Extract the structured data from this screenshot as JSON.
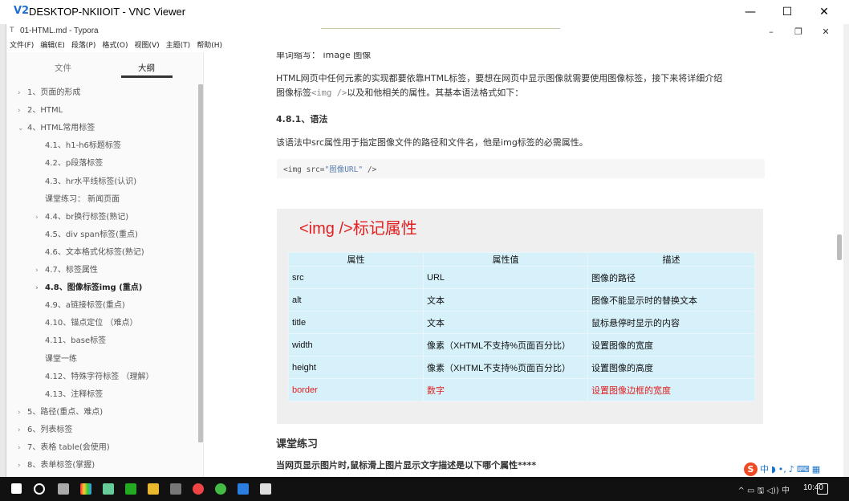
{
  "vnc": {
    "logo": "V2",
    "title": "DESKTOP-NKIIOIT - VNC Viewer",
    "minimize": "—",
    "maximize": "☐",
    "close": "✕"
  },
  "typora": {
    "title": "01-HTML.md - Typora",
    "icon": "T",
    "minimize": "–",
    "restore": "❐",
    "close": "✕"
  },
  "menu": [
    "文件(F)",
    "编辑(E)",
    "段落(P)",
    "格式(O)",
    "视图(V)",
    "主题(T)",
    "帮助(H)"
  ],
  "sidebar": {
    "tab_files": "文件",
    "tab_outline": "大纲",
    "items": [
      {
        "arrow": "›",
        "label": "1、页面的形成"
      },
      {
        "arrow": "›",
        "label": "2、HTML"
      },
      {
        "arrow": "⌄",
        "label": "4、HTML常用标签"
      },
      {
        "arrow": "",
        "label": "4.1、h1-h6标题标签"
      },
      {
        "arrow": "",
        "label": "4.2、p段落标签"
      },
      {
        "arrow": "",
        "label": "4.3、hr水平线标签(认识)"
      },
      {
        "arrow": "",
        "label": "课堂练习： 新闻页面"
      },
      {
        "arrow": "›",
        "label": "4.4、br换行标签(熟记)"
      },
      {
        "arrow": "",
        "label": "4.5、div span标签(重点)"
      },
      {
        "arrow": "",
        "label": "4.6、文本格式化标签(熟记)"
      },
      {
        "arrow": "›",
        "label": "4.7、标签属性"
      },
      {
        "arrow": "›",
        "label": "4.8、图像标签img (重点)"
      },
      {
        "arrow": "",
        "label": "4.9、a链接标签(重点)"
      },
      {
        "arrow": "",
        "label": "4.10、锚点定位 （难点）"
      },
      {
        "arrow": "",
        "label": "4.11、base标签"
      },
      {
        "arrow": "",
        "label": "课堂一练"
      },
      {
        "arrow": "",
        "label": "4.12、特殊字符标签 （理解）"
      },
      {
        "arrow": "",
        "label": "4.13、注释标签"
      },
      {
        "arrow": "›",
        "label": "5、路径(重点、难点)"
      },
      {
        "arrow": "›",
        "label": "6、列表标签"
      },
      {
        "arrow": "›",
        "label": "7、表格 table(会使用)"
      },
      {
        "arrow": "›",
        "label": "8、表单标签(掌握)"
      }
    ],
    "footer_prev": "‹",
    "footer_src": "</>"
  },
  "editor": {
    "word_abbr": "单词缩写：  image  图像",
    "intro_1": "HTML网页中任何元素的实现都要依靠HTML标签，要想在网页中显示图像就需要使用图像标签，接下来将详细介绍",
    "intro_2a": "图像标签",
    "intro_2code": "<img />",
    "intro_2b": "以及和他相关的属性。其基本语法格式如下：",
    "h_syntax": "4.8.1、语法",
    "syntax_desc": "该语法中src属性用于指定图像文件的路径和文件名，他是img标签的必需属性。",
    "code_pre": "<img src=",
    "code_str": "\"图像URL\"",
    "code_post": " />",
    "img_heading": "<img />标记属性",
    "table_headers": [
      "属性",
      "属性值",
      "描述"
    ],
    "table_rows": [
      [
        "src",
        "URL",
        "图像的路径"
      ],
      [
        "alt",
        "文本",
        "图像不能显示时的替换文本"
      ],
      [
        "title",
        "文本",
        "鼠标悬停时显示的内容"
      ],
      [
        "width",
        "像素（XHTML不支持%页面百分比）",
        "设置图像的宽度"
      ],
      [
        "height",
        "像素（XHTML不支持%页面百分比）",
        "设置图像的高度"
      ],
      [
        "border",
        "数字",
        "设置图像边框的宽度"
      ]
    ],
    "h_practice": "课堂练习",
    "question": "当网页显示图片时,鼠标滑上图片显示文字描述是以下哪个属性****"
  },
  "ime": {
    "logo": "S",
    "lang": "中"
  },
  "taskbar": {
    "tray": "^ ▭ 🖫 ◁)) 中",
    "clock": "10:40",
    "colors": {
      "bar": "#111111",
      "accent": "#1f6fd2"
    }
  }
}
